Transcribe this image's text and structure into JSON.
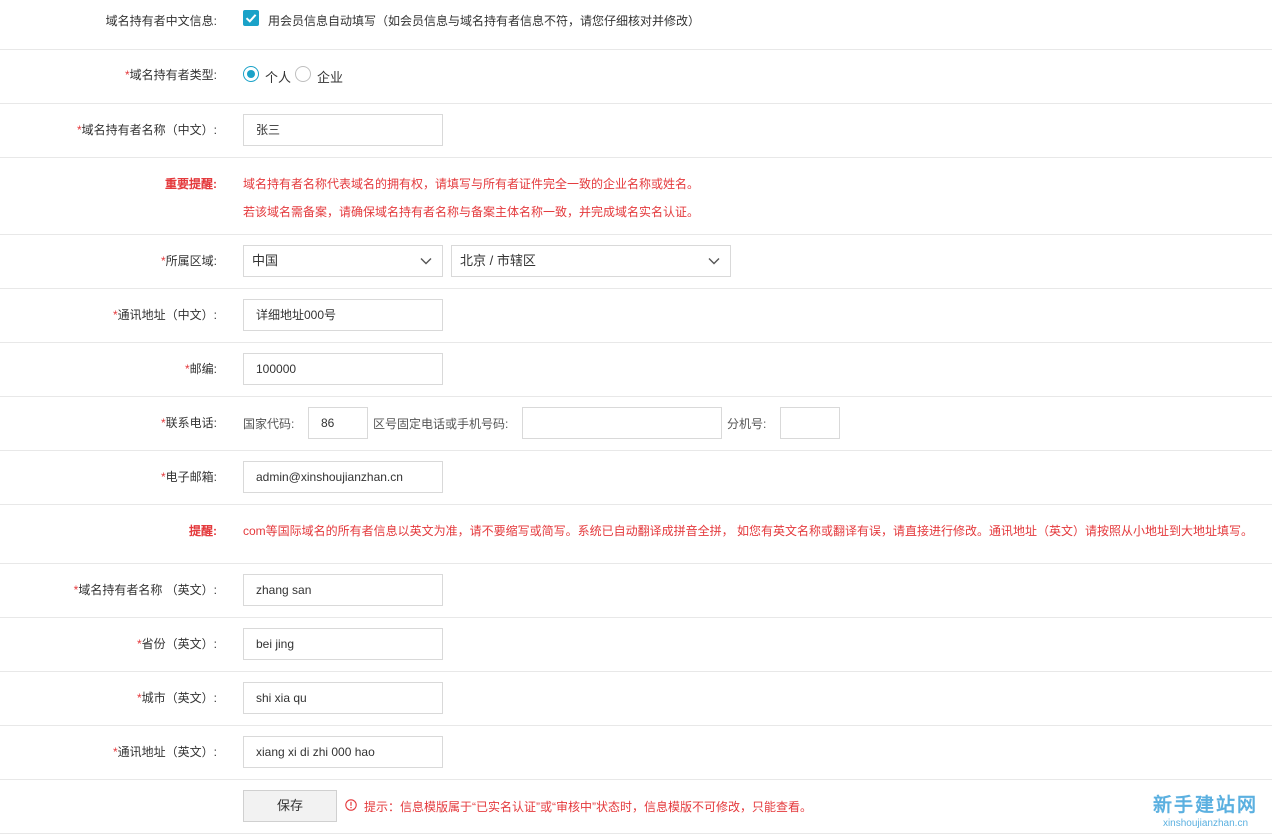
{
  "auto_fill": {
    "label": "域名持有者中文信息:",
    "checkbox_text": "用会员信息自动填写（如会员信息与域名持有者信息不符，请您仔细核对并修改）",
    "checked": true
  },
  "holder_type": {
    "required": "*",
    "label": "域名持有者类型:",
    "options": [
      "个人",
      "企业"
    ],
    "selected": "个人"
  },
  "holder_name_cn": {
    "required": "*",
    "label": "域名持有者名称（中文）:",
    "value": "张三"
  },
  "important_notice": {
    "label": "重要提醒:",
    "lines": [
      "域名持有者名称代表域名的拥有权，请填写与所有者证件完全一致的企业名称或姓名。",
      "若该域名需备案，请确保域名持有者名称与备案主体名称一致，并完成域名实名认证。"
    ]
  },
  "region": {
    "required": "*",
    "label": "所属区域:",
    "country": "中国",
    "city": "北京 / 市辖区"
  },
  "address_cn": {
    "required": "*",
    "label": "通讯地址（中文）:",
    "value": "详细地址000号"
  },
  "postcode": {
    "required": "*",
    "label": "邮编:",
    "value": "100000"
  },
  "phone": {
    "required": "*",
    "label": "联系电话:",
    "country_code_label": "国家代码:",
    "country_code": "86",
    "number_label": "区号固定电话或手机号码:",
    "number": "",
    "ext_label": "分机号:",
    "ext": ""
  },
  "email": {
    "required": "*",
    "label": "电子邮箱:",
    "value": "admin@xinshoujianzhan.cn"
  },
  "tip": {
    "label": "提醒:",
    "text": "com等国际域名的所有者信息以英文为准，请不要缩写或简写。系统已自动翻译成拼音全拼， 如您有英文名称或翻译有误，请直接进行修改。通讯地址（英文）请按照从小地址到大地址填写。"
  },
  "holder_name_en": {
    "required": "*",
    "label": "域名持有者名称 （英文）:",
    "value": "zhang san"
  },
  "province_en": {
    "required": "*",
    "label": "省份（英文）:",
    "value": "bei jing"
  },
  "city_en": {
    "required": "*",
    "label": "城市（英文）:",
    "value": "shi xia qu"
  },
  "address_en": {
    "required": "*",
    "label": "通讯地址（英文）:",
    "value": "xiang xi di zhi 000 hao"
  },
  "footer": {
    "save_label": "保存",
    "hint": "提示：信息模版属于“已实名认证”或“审核中”状态时，信息模版不可修改，只能查看。"
  },
  "watermark": {
    "title": "新手建站网",
    "url": "xinshoujianzhan.cn"
  },
  "colors": {
    "accent": "#1aa2c8",
    "warning": "#e4393c",
    "border": "#d9d9d9"
  }
}
